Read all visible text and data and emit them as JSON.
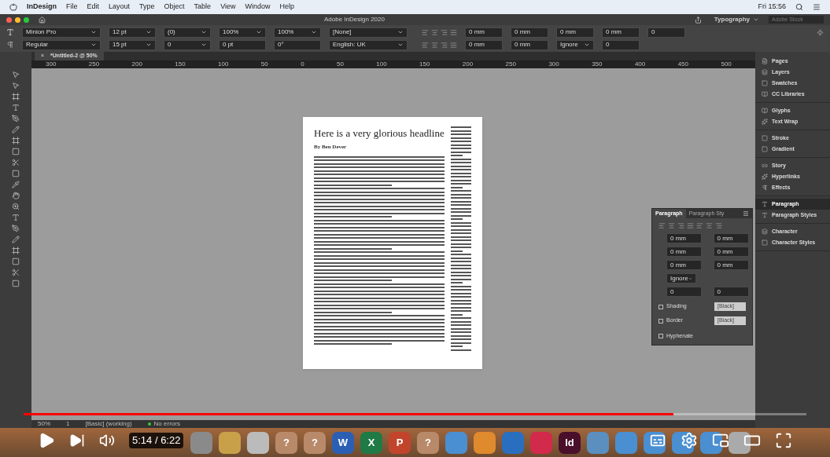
{
  "menubar": {
    "app": "InDesign",
    "menus": [
      "File",
      "Edit",
      "Layout",
      "Type",
      "Object",
      "Table",
      "View",
      "Window",
      "Help"
    ],
    "clock": "Fri 15:56"
  },
  "titlebar": {
    "title": "Adobe InDesign 2020",
    "workspace": "Typography",
    "search_placeholder": "Adobe Stock"
  },
  "control_bar": {
    "row1": [
      {
        "kind": "select",
        "value": "Minion Pro"
      },
      {
        "kind": "select",
        "value": "12 pt"
      },
      {
        "kind": "select",
        "value": "(0)"
      },
      {
        "kind": "select",
        "value": "100%"
      },
      {
        "kind": "select",
        "value": "100%"
      },
      {
        "kind": "select",
        "value": "[None]"
      }
    ],
    "row2": [
      {
        "kind": "select",
        "value": "Regular"
      },
      {
        "kind": "select",
        "value": "15 pt"
      },
      {
        "kind": "select",
        "value": "0"
      },
      {
        "kind": "field",
        "value": "0 pt"
      },
      {
        "kind": "field",
        "value": "0°"
      },
      {
        "kind": "select",
        "value": "English: UK"
      }
    ],
    "para1": [
      "0 mm",
      "0 mm",
      "0 mm",
      "0 mm",
      "0"
    ],
    "para2": [
      "0 mm",
      "0 mm",
      "Ignore",
      "0"
    ]
  },
  "document_tab": {
    "close": "×",
    "title": "*Untitled-2 @ 50%"
  },
  "ruler": [
    "300",
    "250",
    "200",
    "150",
    "100",
    "50",
    "0",
    "50",
    "100",
    "150",
    "200",
    "250",
    "300",
    "350",
    "400",
    "450",
    "500"
  ],
  "document": {
    "headline": "Here is a very glorious headline",
    "byline": "By Ben Dever"
  },
  "paragraph_panel": {
    "tabs": [
      {
        "label": "Paragraph",
        "selected": true
      },
      {
        "label": "Paragraph Sty",
        "selected": false
      }
    ],
    "fields": [
      "0 mm",
      "0 mm",
      "0 mm",
      "0 mm",
      "0 mm",
      "0 mm"
    ],
    "ignore": "Ignore",
    "grid": [
      "0",
      "0"
    ],
    "options": [
      {
        "label": "Shading",
        "checked": false,
        "swatch": "[Black]"
      },
      {
        "label": "Border",
        "checked": false,
        "swatch": "[Black]"
      }
    ],
    "hyphenate": {
      "label": "Hyphenate",
      "checked": false
    }
  },
  "panel_dock": [
    [
      {
        "label": "Pages",
        "selected": false
      },
      {
        "label": "Layers",
        "selected": false
      },
      {
        "label": "Swatches",
        "selected": false
      },
      {
        "label": "CC Libraries",
        "selected": false
      }
    ],
    [
      {
        "label": "Glyphs",
        "selected": false
      },
      {
        "label": "Text Wrap",
        "selected": false
      }
    ],
    [
      {
        "label": "Stroke",
        "selected": false
      },
      {
        "label": "Gradient",
        "selected": false
      }
    ],
    [
      {
        "label": "Story",
        "selected": false
      },
      {
        "label": "Hyperlinks",
        "selected": false
      },
      {
        "label": "Effects",
        "selected": false
      }
    ],
    [
      {
        "label": "Paragraph",
        "selected": true
      },
      {
        "label": "Paragraph Styles",
        "selected": false
      }
    ],
    [
      {
        "label": "Character",
        "selected": false
      },
      {
        "label": "Character Styles",
        "selected": false
      }
    ]
  ],
  "status_bar": {
    "zoom": "50%",
    "page": "1",
    "profile": "[Basic] (working)",
    "preflight": "No errors"
  },
  "video": {
    "time": "5:14 / 6:22",
    "level": 0.83
  },
  "dock": [
    {
      "color": "#8a8a8a"
    },
    {
      "color": "#c9a04a"
    },
    {
      "color": "#bbbbbb"
    },
    {
      "color": "#b98a6a",
      "glyph": "?"
    },
    {
      "color": "#b98a6a",
      "glyph": "?"
    },
    {
      "color": "#2b5fb4",
      "glyph": "W"
    },
    {
      "color": "#1f7a45",
      "glyph": "X"
    },
    {
      "color": "#c2452b",
      "glyph": "P"
    },
    {
      "color": "#b98a6a",
      "glyph": "?"
    },
    {
      "color": "#4a8fd1"
    },
    {
      "color": "#e08a2e"
    },
    {
      "color": "#2a6fbf"
    },
    {
      "color": "#d12a4a"
    },
    {
      "color": "#4a0f2a",
      "glyph": "Id"
    },
    {
      "color": "#5a8fc0"
    },
    {
      "color": "#4a8fd1"
    },
    {
      "color": "#4a8fd1"
    },
    {
      "color": "#4a8fd1"
    },
    {
      "color": "#4a8fd1"
    },
    {
      "color": "#aaaaaa"
    }
  ]
}
